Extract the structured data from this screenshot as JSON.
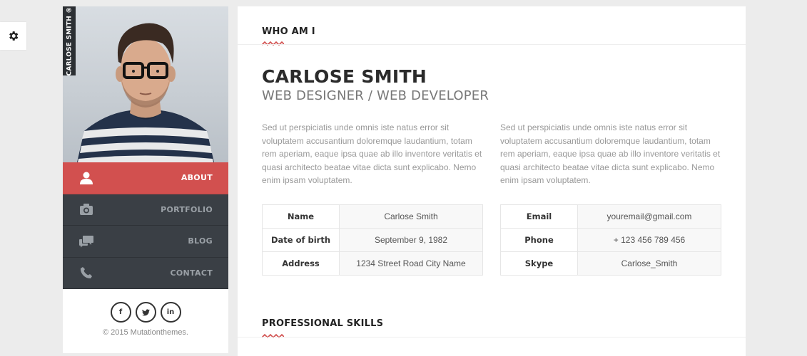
{
  "settings": {
    "icon": "gear-icon"
  },
  "profile": {
    "vertical_name": "CARLOSE SMITH ®"
  },
  "nav": {
    "items": [
      {
        "label": "ABOUT",
        "icon": "user-icon"
      },
      {
        "label": "PORTFOLIO",
        "icon": "camera-icon"
      },
      {
        "label": "BLOG",
        "icon": "chat-icon"
      },
      {
        "label": "CONTACT",
        "icon": "phone-icon"
      }
    ],
    "active_color": "#d2504f"
  },
  "social": {
    "facebook": "f",
    "twitter": "t",
    "linkedin": "in"
  },
  "footer": {
    "copyright": "© 2015 Mutationthemes."
  },
  "about": {
    "section_title": "WHO AM I",
    "name": "CARLOSE SMITH",
    "role": "WEB DESIGNER / WEB DEVELOPER",
    "paragraph_left": "Sed ut perspiciatis unde omnis iste natus error sit voluptatem accusantium doloremque laudantium, totam rem aperiam, eaque ipsa quae ab illo inventore veritatis et quasi architecto beatae vitae dicta sunt explicabo. Nemo enim ipsam voluptatem.",
    "paragraph_right": "Sed ut perspiciatis unde omnis iste natus error sit voluptatem accusantium doloremque laudantium, totam rem aperiam, eaque ipsa quae ab illo inventore veritatis et quasi architecto beatae vitae dicta sunt explicabo. Nemo enim ipsam voluptatem.",
    "info_left": [
      {
        "key": "Name",
        "value": "Carlose Smith"
      },
      {
        "key": "Date of birth",
        "value": "September 9, 1982"
      },
      {
        "key": "Address",
        "value": "1234 Street Road City Name"
      }
    ],
    "info_right": [
      {
        "key": "Email",
        "value": "youremail@gmail.com"
      },
      {
        "key": "Phone",
        "value": "+ 123 456 789 456"
      },
      {
        "key": "Skype",
        "value": "Carlose_Smith"
      }
    ]
  },
  "skills": {
    "section_title": "PROFESSIONAL SKILLS"
  },
  "colors": {
    "accent": "#d2504f",
    "sidebar_dark": "#3a3f45"
  }
}
